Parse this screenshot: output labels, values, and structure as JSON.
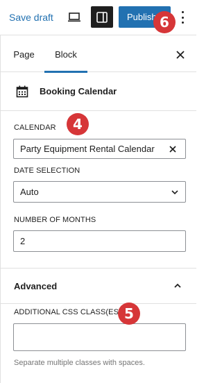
{
  "toolbar": {
    "save_draft": "Save draft",
    "publish": "Publish",
    "device_icon": "laptop-icon",
    "settings_icon": "sidebar-toggle-icon",
    "options_icon": "more-vertical-icon"
  },
  "tabs": {
    "page": "Page",
    "block": "Block",
    "active": "Block"
  },
  "block": {
    "icon": "calendar-icon",
    "title": "Booking Calendar"
  },
  "fields": {
    "calendar_label": "CALENDAR",
    "calendar_value": "Party Equipment Rental Calendar",
    "date_selection_label": "DATE SELECTION",
    "date_selection_value": "Auto",
    "months_label": "NUMBER OF MONTHS",
    "months_value": "2"
  },
  "advanced": {
    "title": "Advanced",
    "css_label": "ADDITIONAL CSS CLASS(ES)",
    "css_value": "",
    "help_text": "Separate multiple classes with spaces."
  },
  "annotations": {
    "badge_4": "4",
    "badge_5": "5",
    "badge_6": "6"
  },
  "colors": {
    "accent": "#2271b1",
    "badge": "#d63638",
    "dark": "#1e1e1e"
  }
}
